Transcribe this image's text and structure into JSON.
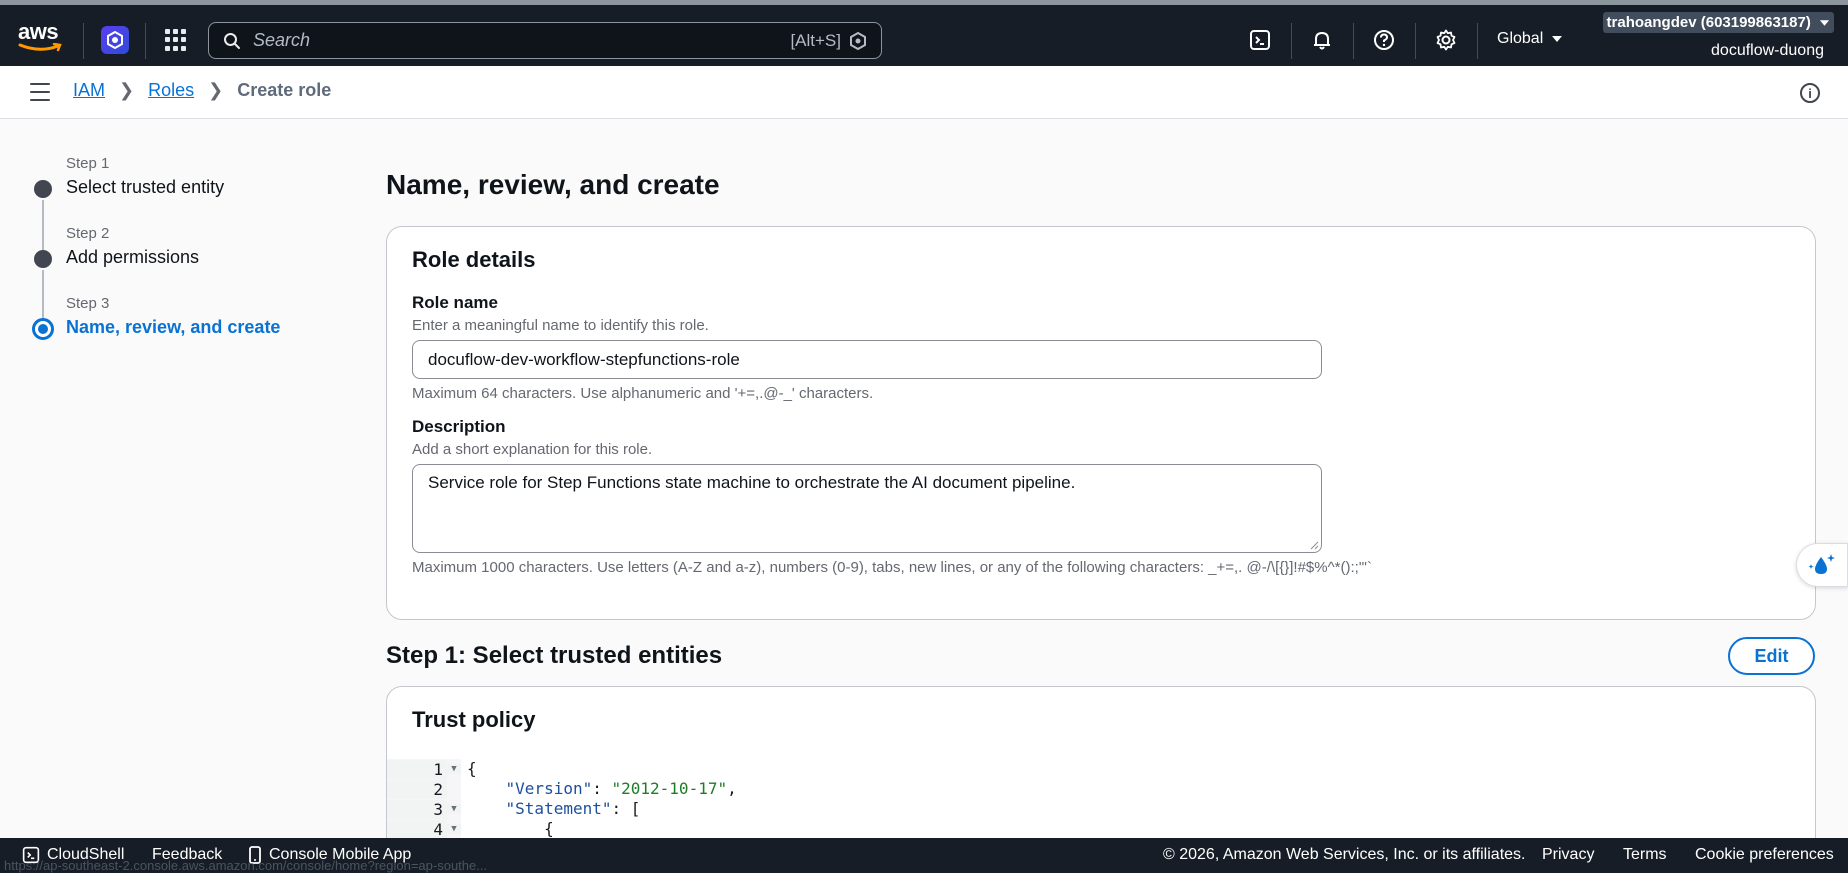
{
  "topnav": {
    "logo_text": "aws",
    "search_placeholder": "Search",
    "search_shortcut": "[Alt+S]",
    "region": "Global",
    "account": "trahoangdev (603199863187)",
    "account_sub": "docuflow-duong",
    "icons": [
      "cloudshell-icon",
      "bell-icon",
      "help-icon",
      "gear-icon"
    ]
  },
  "breadcrumb": {
    "items": [
      "IAM",
      "Roles"
    ],
    "current": "Create role"
  },
  "steps": [
    {
      "label": "Step 1",
      "title": "Select trusted entity",
      "state": "done"
    },
    {
      "label": "Step 2",
      "title": "Add permissions",
      "state": "done"
    },
    {
      "label": "Step 3",
      "title": "Name, review, and create",
      "state": "active"
    }
  ],
  "page": {
    "title": "Name, review, and create"
  },
  "role_details": {
    "heading": "Role details",
    "role_name_label": "Role name",
    "role_name_desc": "Enter a meaningful name to identify this role.",
    "role_name_value": "docuflow-dev-workflow-stepfunctions-role",
    "role_name_constraint": "Maximum 64 characters. Use alphanumeric and '+=,.@-_' characters.",
    "description_label": "Description",
    "description_desc": "Add a short explanation for this role.",
    "description_value": "Service role for Step Functions state machine to orchestrate the AI document pipeline.",
    "description_constraint": "Maximum 1000 characters. Use letters (A-Z and a-z), numbers (0-9), tabs, new lines, or any of the following characters: _+=,. @-/\\[{}]!#$%^*():;\"'`"
  },
  "step1": {
    "title": "Step 1: Select trusted entities",
    "edit_label": "Edit"
  },
  "trust_policy": {
    "heading": "Trust policy",
    "lines": [
      {
        "num": "1",
        "fold": true,
        "indent": "",
        "key": "",
        "sep": "",
        "value": "",
        "tail": "{"
      },
      {
        "num": "2",
        "fold": false,
        "indent": "    ",
        "key": "\"Version\"",
        "sep": ": ",
        "value": "\"2012-10-17\"",
        "tail": ","
      },
      {
        "num": "3",
        "fold": true,
        "indent": "    ",
        "key": "\"Statement\"",
        "sep": ": ",
        "value": "",
        "tail": "["
      },
      {
        "num": "4",
        "fold": true,
        "indent": "        ",
        "key": "",
        "sep": "",
        "value": "",
        "tail": "{"
      }
    ]
  },
  "footer": {
    "cloudshell": "CloudShell",
    "feedback": "Feedback",
    "mobile_app": "Console Mobile App",
    "copyright": "© 2026, Amazon Web Services, Inc. or its affiliates.",
    "privacy": "Privacy",
    "terms": "Terms",
    "cookies": "Cookie preferences",
    "status_url": "https://ap-southeast-2.console.aws.amazon.com/console/home?region=ap-southe..."
  },
  "colors": {
    "nav_bg": "#161d26",
    "link": "#0972d3",
    "string": "#1d7d27",
    "key": "#1c4f9c"
  }
}
